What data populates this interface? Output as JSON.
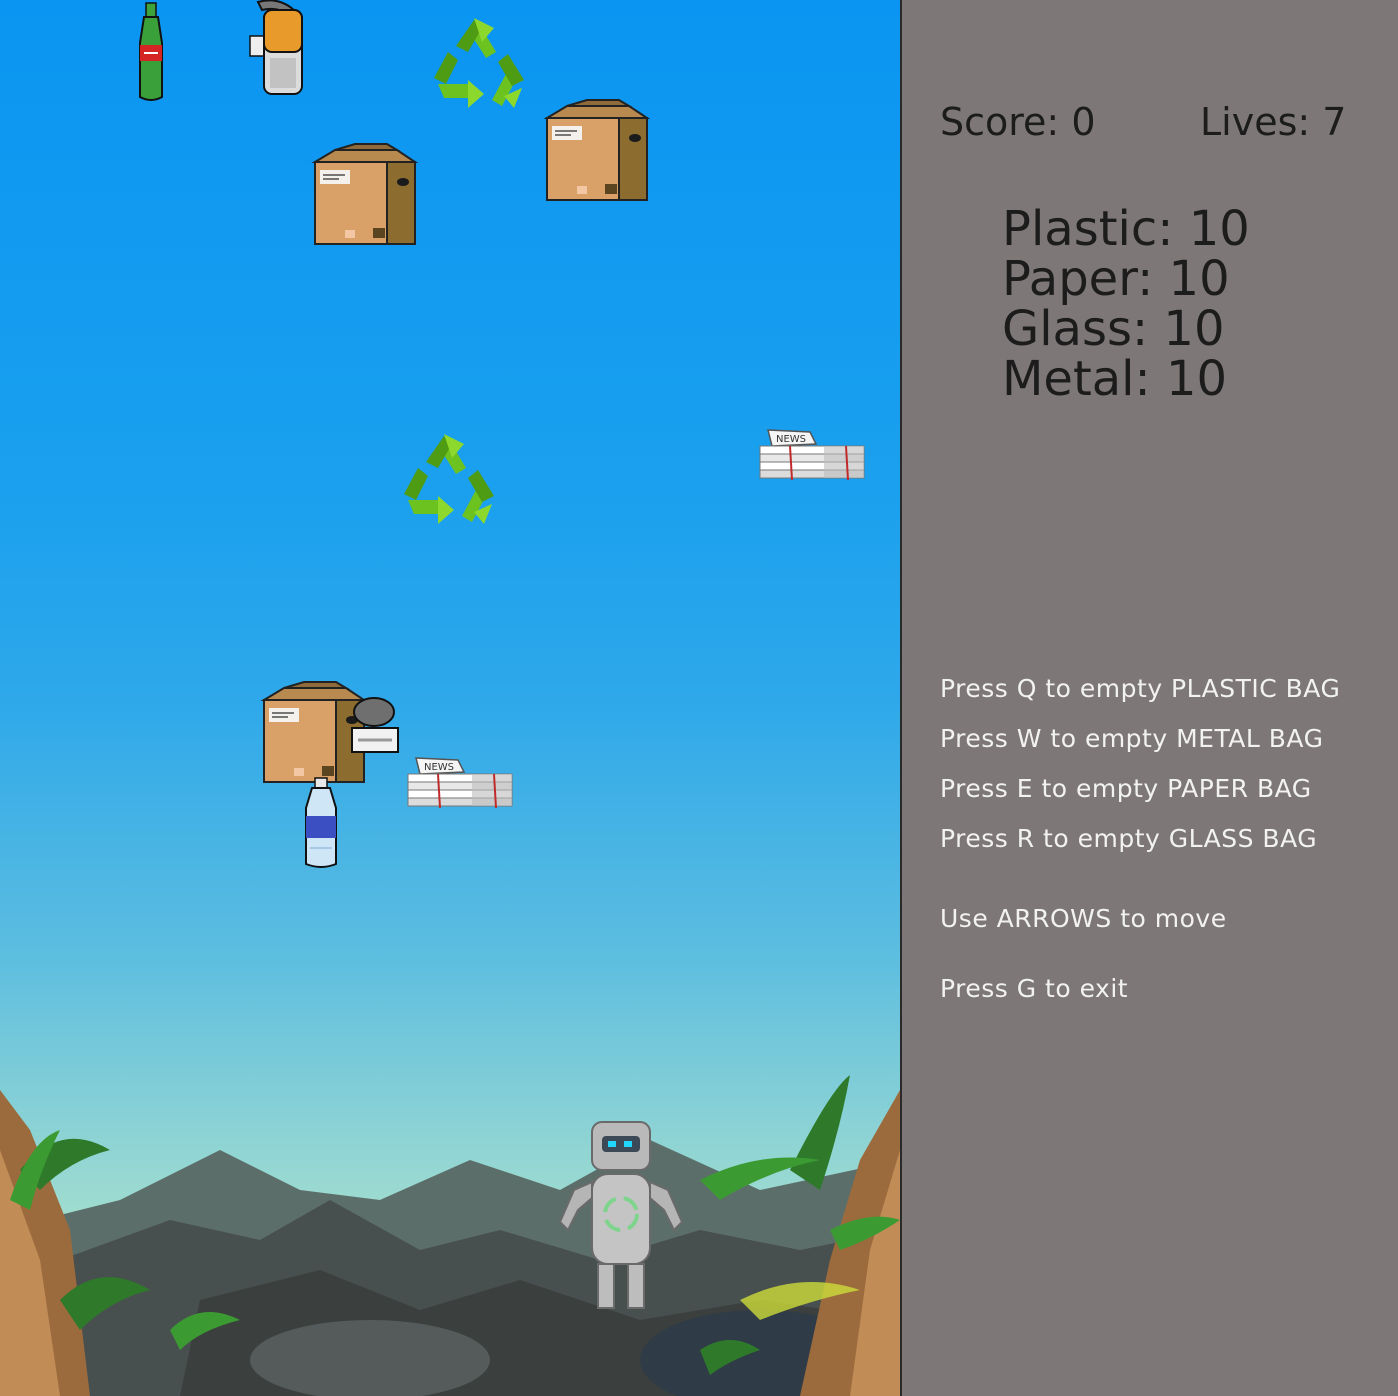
{
  "hud": {
    "score_label": "Score:",
    "score_value": "0",
    "lives_label": "Lives:",
    "lives_value": "7"
  },
  "bags": [
    {
      "label": "Plastic:",
      "value": "10"
    },
    {
      "label": "Paper:",
      "value": "10"
    },
    {
      "label": "Glass:",
      "value": "10"
    },
    {
      "label": "Metal:",
      "value": "10"
    }
  ],
  "instructions": [
    "Press Q to empty PLASTIC BAG",
    "Press W to empty METAL BAG",
    "Press E to empty PAPER BAG",
    "Press R to empty GLASS BAG",
    "Use ARROWS to move",
    "Press G to exit"
  ],
  "sprites": {
    "newspaper_text": "NEWS"
  },
  "colors": {
    "sky_top": "#0a95f2",
    "sky_bottom": "#b9e6c8",
    "panel": "#7e7777",
    "recycle_green": "#6cc21f",
    "cardboard": "#d9a067"
  }
}
